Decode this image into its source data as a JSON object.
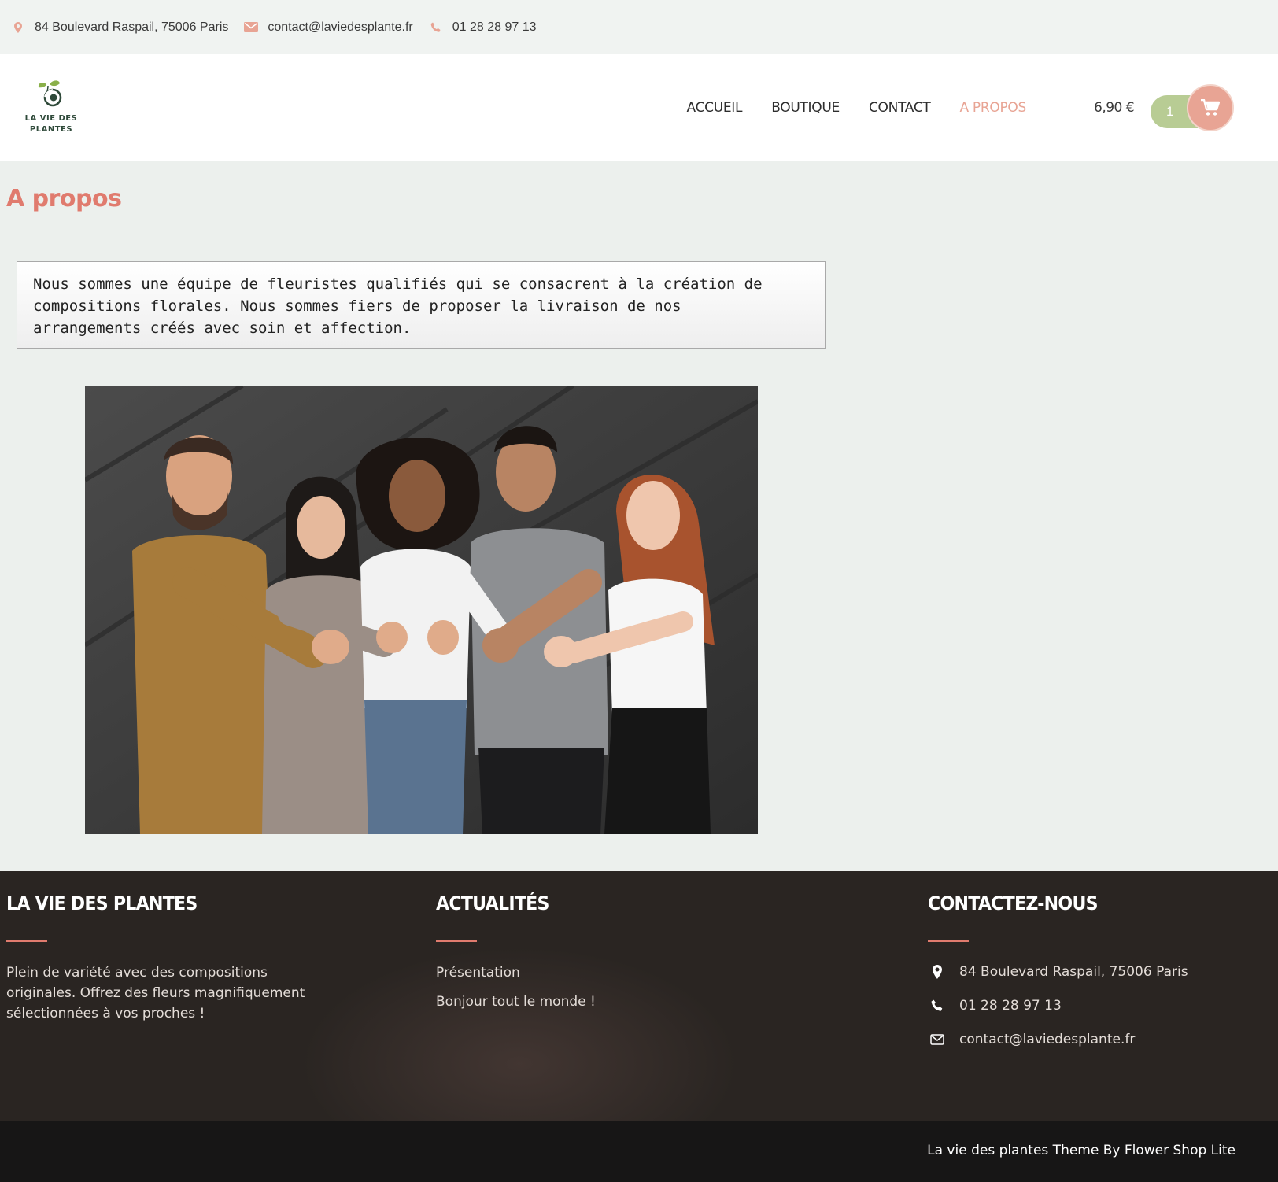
{
  "topbar": {
    "address": "84 Boulevard Raspail, 75006 Paris",
    "email": "contact@laviedesplante.fr",
    "phone": "01 28 28 97 13"
  },
  "header": {
    "logo_line1": "LA VIE DES",
    "logo_line2": "PLANTES",
    "nav": [
      {
        "label": "ACCUEIL",
        "active": false
      },
      {
        "label": "BOUTIQUE",
        "active": false
      },
      {
        "label": "CONTACT",
        "active": false
      },
      {
        "label": "A PROPOS",
        "active": true
      }
    ],
    "cart_total": "6,90 €",
    "cart_count": "1"
  },
  "main": {
    "title": "A propos",
    "intro_line1": "Nous sommes une équipe de fleuristes qualifiés qui se consacrent à la création de",
    "intro_line2": "compositions florales. Nous sommes fiers de proposer la livraison de nos",
    "intro_line3": "arrangements créés avec soin et affection."
  },
  "footer": {
    "col1_title": "LA VIE DES PLANTES",
    "col1_line1": "Plein de variété avec des compositions",
    "col1_line2": "originales. Offrez des fleurs magnifiquement",
    "col1_line3": "sélectionnées à vos proches !",
    "col2_title": "ACTUALITÉS",
    "col2_links": [
      "Présentation",
      "Bonjour tout le monde !"
    ],
    "col3_title": "CONTACTEZ-NOUS",
    "col3_address": "84 Boulevard Raspail, 75006 Paris",
    "col3_phone": "01 28 28 97 13",
    "col3_email": "contact@laviedesplante.fr",
    "credits": "La vie des plantes Theme By Flower Shop Lite"
  },
  "colors": {
    "accent": "#e8a494",
    "title": "#e07b6e",
    "cart_pill": "#b8cc94",
    "footer_bg": "#2a2522"
  },
  "icons": [
    "map-pin-icon",
    "envelope-icon",
    "phone-icon",
    "cart-icon"
  ]
}
